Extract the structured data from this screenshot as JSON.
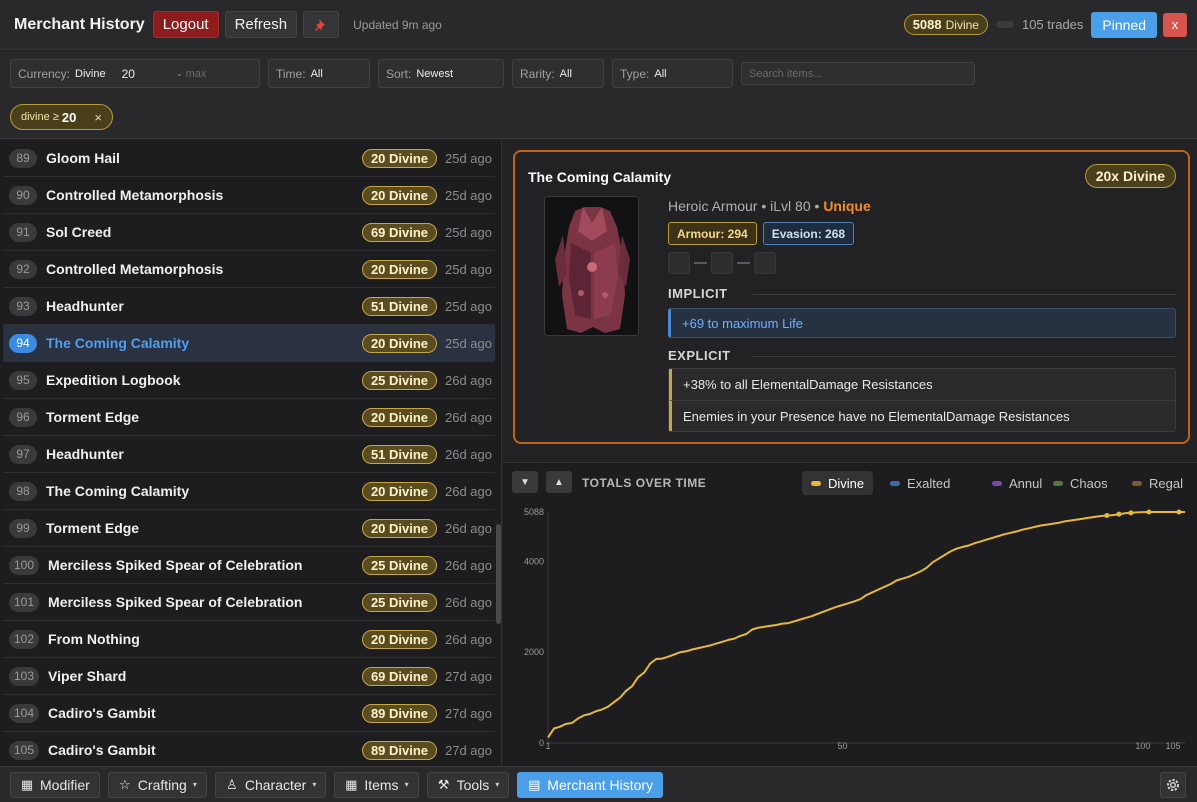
{
  "header": {
    "title": "Merchant History",
    "logout_label": "Logout",
    "refresh_label": "Refresh",
    "updated_text": "Updated 9m ago",
    "total_value": "5088",
    "total_currency": "Divine",
    "trades_text": "105 trades",
    "pinned_label": "Pinned",
    "close_label": "x"
  },
  "filters": {
    "currency_label": "Currency:",
    "currency_value": "Divine",
    "min_value": "20",
    "max_placeholder": "max",
    "time_label": "Time:",
    "time_value": "All",
    "sort_label": "Sort:",
    "sort_value": "Newest",
    "rarity_label": "Rarity:",
    "rarity_value": "All",
    "type_label": "Type:",
    "type_value": "All",
    "search_placeholder": "Search items...",
    "chip_label": "divine ≥",
    "chip_value": "20",
    "chip_remove": "×"
  },
  "list": [
    {
      "idx": "89",
      "name": "Gloom Hail",
      "price": "20 Divine",
      "ago": "25d ago"
    },
    {
      "idx": "90",
      "name": "Controlled Metamorphosis",
      "price": "20 Divine",
      "ago": "25d ago"
    },
    {
      "idx": "91",
      "name": "Sol Creed",
      "price": "69 Divine",
      "ago": "25d ago"
    },
    {
      "idx": "92",
      "name": "Controlled Metamorphosis",
      "price": "20 Divine",
      "ago": "25d ago"
    },
    {
      "idx": "93",
      "name": "Headhunter",
      "price": "51 Divine",
      "ago": "25d ago"
    },
    {
      "idx": "94",
      "name": "The Coming Calamity",
      "price": "20 Divine",
      "ago": "25d ago"
    },
    {
      "idx": "95",
      "name": "Expedition Logbook",
      "price": "25 Divine",
      "ago": "26d ago"
    },
    {
      "idx": "96",
      "name": "Torment Edge",
      "price": "20 Divine",
      "ago": "26d ago"
    },
    {
      "idx": "97",
      "name": "Headhunter",
      "price": "51 Divine",
      "ago": "26d ago"
    },
    {
      "idx": "98",
      "name": "The Coming Calamity",
      "price": "20 Divine",
      "ago": "26d ago"
    },
    {
      "idx": "99",
      "name": "Torment Edge",
      "price": "20 Divine",
      "ago": "26d ago"
    },
    {
      "idx": "100",
      "name": "Merciless Spiked Spear of Celebration",
      "price": "25 Divine",
      "ago": "26d ago"
    },
    {
      "idx": "101",
      "name": "Merciless Spiked Spear of Celebration",
      "price": "25 Divine",
      "ago": "26d ago"
    },
    {
      "idx": "102",
      "name": "From Nothing",
      "price": "20 Divine",
      "ago": "26d ago"
    },
    {
      "idx": "103",
      "name": "Viper Shard",
      "price": "69 Divine",
      "ago": "27d ago"
    },
    {
      "idx": "104",
      "name": "Cadiro's Gambit",
      "price": "89 Divine",
      "ago": "27d ago"
    },
    {
      "idx": "105",
      "name": "Cadiro's Gambit",
      "price": "89 Divine",
      "ago": "27d ago"
    }
  ],
  "selected_index": 5,
  "detail": {
    "title": "The Coming Calamity",
    "price": "20x Divine",
    "base": "Heroic Armour",
    "ilvl": "iLvl 80",
    "sep": "•",
    "rarity": "Unique",
    "armour": "Armour: 294",
    "evasion": "Evasion: 268",
    "implicit_header": "IMPLICIT",
    "implicit": "+69 to maximum Life",
    "explicit_header": "EXPLICIT",
    "explicit": [
      "+38% to all ElementalDamage Resistances",
      "Enemies in your Presence have no ElementalDamage Resistances"
    ]
  },
  "chart": {
    "title": "TOTALS OVER TIME",
    "collapse_icon": "▼",
    "expand_icon": "▲",
    "legend": [
      {
        "name": "Divine",
        "color": "#e6b93a",
        "active": true
      },
      {
        "name": "Exalted",
        "color": "#3f6aa8",
        "active": false
      },
      {
        "name": "Annul",
        "color": "#7a4aa8",
        "active": false
      },
      {
        "name": "Chaos",
        "color": "#4f7a3a",
        "active": false
      },
      {
        "name": "Regal",
        "color": "#7a5a3a",
        "active": false
      }
    ]
  },
  "chart_data": {
    "type": "line",
    "title": "TOTALS OVER TIME",
    "xlabel": "",
    "ylabel": "",
    "x_ticks": [
      1,
      50,
      100,
      105
    ],
    "y_ticks": [
      0,
      2000,
      4000,
      5088
    ],
    "xlim": [
      1,
      107
    ],
    "ylim": [
      0,
      5088
    ],
    "series": [
      {
        "name": "Divine",
        "color": "#e6b93a",
        "x": [
          1,
          2,
          3,
          4,
          5,
          6,
          7,
          8,
          9,
          10,
          11,
          12,
          13,
          14,
          15,
          16,
          17,
          18,
          19,
          20,
          21,
          22,
          23,
          24,
          25,
          26,
          27,
          28,
          29,
          30,
          31,
          32,
          33,
          34,
          35,
          36,
          37,
          38,
          39,
          40,
          41,
          42,
          43,
          44,
          45,
          46,
          47,
          48,
          49,
          50,
          51,
          52,
          53,
          54,
          55,
          56,
          57,
          58,
          59,
          60,
          61,
          62,
          63,
          64,
          65,
          66,
          67,
          68,
          69,
          70,
          71,
          72,
          73,
          74,
          75,
          76,
          77,
          78,
          79,
          80,
          81,
          82,
          83,
          84,
          85,
          86,
          87,
          88,
          89,
          90,
          91,
          92,
          93,
          94,
          95,
          96,
          97,
          98,
          99,
          100,
          101,
          102,
          103,
          104,
          105,
          106,
          107
        ],
        "values": [
          120,
          320,
          360,
          420,
          440,
          540,
          610,
          640,
          700,
          740,
          800,
          900,
          1000,
          1150,
          1250,
          1450,
          1550,
          1750,
          1850,
          1860,
          1900,
          1950,
          2000,
          2020,
          2060,
          2090,
          2120,
          2150,
          2190,
          2230,
          2270,
          2300,
          2360,
          2400,
          2500,
          2540,
          2560,
          2580,
          2600,
          2630,
          2640,
          2680,
          2720,
          2760,
          2800,
          2850,
          2900,
          2950,
          3000,
          3040,
          3080,
          3120,
          3170,
          3260,
          3320,
          3380,
          3440,
          3500,
          3580,
          3620,
          3660,
          3720,
          3780,
          3860,
          3980,
          4060,
          4140,
          4220,
          4280,
          4320,
          4350,
          4400,
          4440,
          4480,
          4520,
          4560,
          4600,
          4630,
          4660,
          4700,
          4730,
          4760,
          4790,
          4810,
          4830,
          4850,
          4880,
          4900,
          4920,
          4940,
          4960,
          4980,
          5000,
          5010,
          5020,
          5040,
          5060,
          5070,
          5080,
          5085,
          5088,
          5088,
          5088,
          5088,
          5088,
          5088,
          5088
        ]
      }
    ],
    "grid": false
  },
  "footer": {
    "modifier": "Modifier",
    "crafting": "Crafting",
    "character": "Character",
    "items": "Items",
    "tools": "Tools",
    "merchant": "Merchant History",
    "caret": "▾"
  }
}
